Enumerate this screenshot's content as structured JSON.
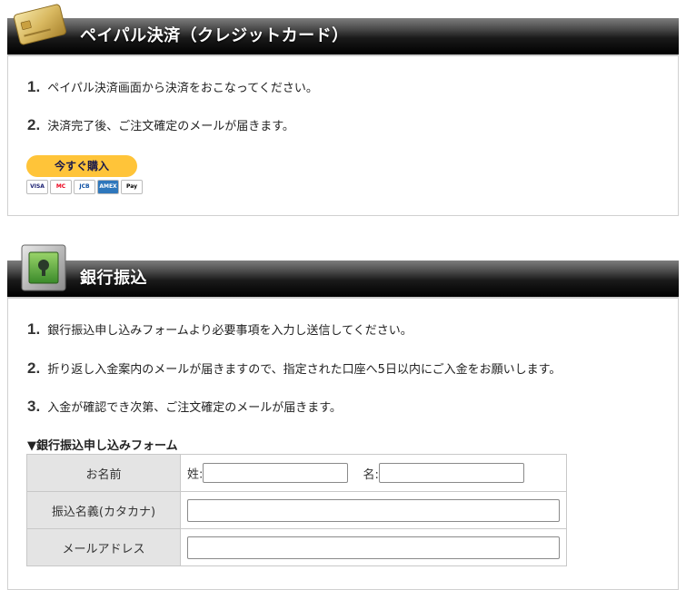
{
  "paypal_section": {
    "title": "ペイパル決済（クレジットカード）",
    "steps": [
      {
        "num": "1.",
        "text": "ペイパル決済画面から決済をおこなってください。"
      },
      {
        "num": "2.",
        "text": "決済完了後、ご注文確定のメールが届きます。"
      }
    ],
    "buy_button_label": "今すぐ購入",
    "card_logos": [
      "VISA",
      "MC",
      "JCB",
      "AMEX",
      "Pay"
    ]
  },
  "bank_section": {
    "title": "銀行振込",
    "steps": [
      {
        "num": "1.",
        "text": "銀行振込申し込みフォームより必要事項を入力し送信してください。"
      },
      {
        "num": "2.",
        "text": "折り返し入金案内のメールが届きますので、指定された口座へ5日以内にご入金をお願いします。"
      },
      {
        "num": "3.",
        "text": "入金が確認でき次第、ご注文確定のメールが届きます。"
      }
    ],
    "form_title": "▼銀行振込申し込みフォーム",
    "form": {
      "name_label": "お名前",
      "last_name_label": "姓:",
      "first_name_label": "名:",
      "kana_label": "振込名義(カタカナ)",
      "email_label": "メールアドレス",
      "last_name_value": "",
      "first_name_value": "",
      "kana_value": "",
      "email_value": ""
    }
  },
  "colors": {
    "header_dark": "#000000",
    "paypal_yellow": "#ffc439",
    "label_bg": "#e4e4e4"
  }
}
